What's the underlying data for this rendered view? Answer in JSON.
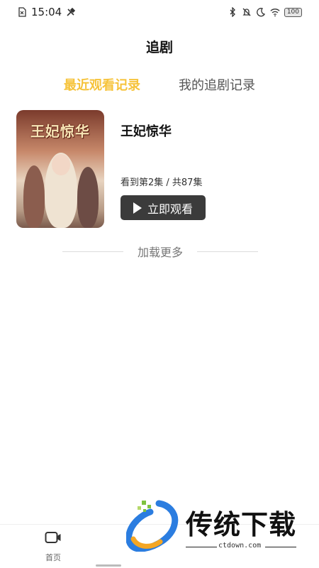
{
  "status_bar": {
    "time": "15:04",
    "battery": "100"
  },
  "page": {
    "title": "追剧"
  },
  "tabs": [
    {
      "label": "最近观看记录",
      "active": true
    },
    {
      "label": "我的追剧记录",
      "active": false
    }
  ],
  "record": {
    "poster_title": "王妃惊华",
    "name": "王妃惊华",
    "progress": "看到第2集 / 共87集",
    "watch_button": "立即观看"
  },
  "load_more": "加载更多",
  "bottom_nav": {
    "home_label": "首页"
  },
  "watermark": {
    "text": "传统下载",
    "url": "ctdown.com"
  },
  "colors": {
    "accent": "#f6c33b",
    "button_bg": "#3b3b3b"
  }
}
